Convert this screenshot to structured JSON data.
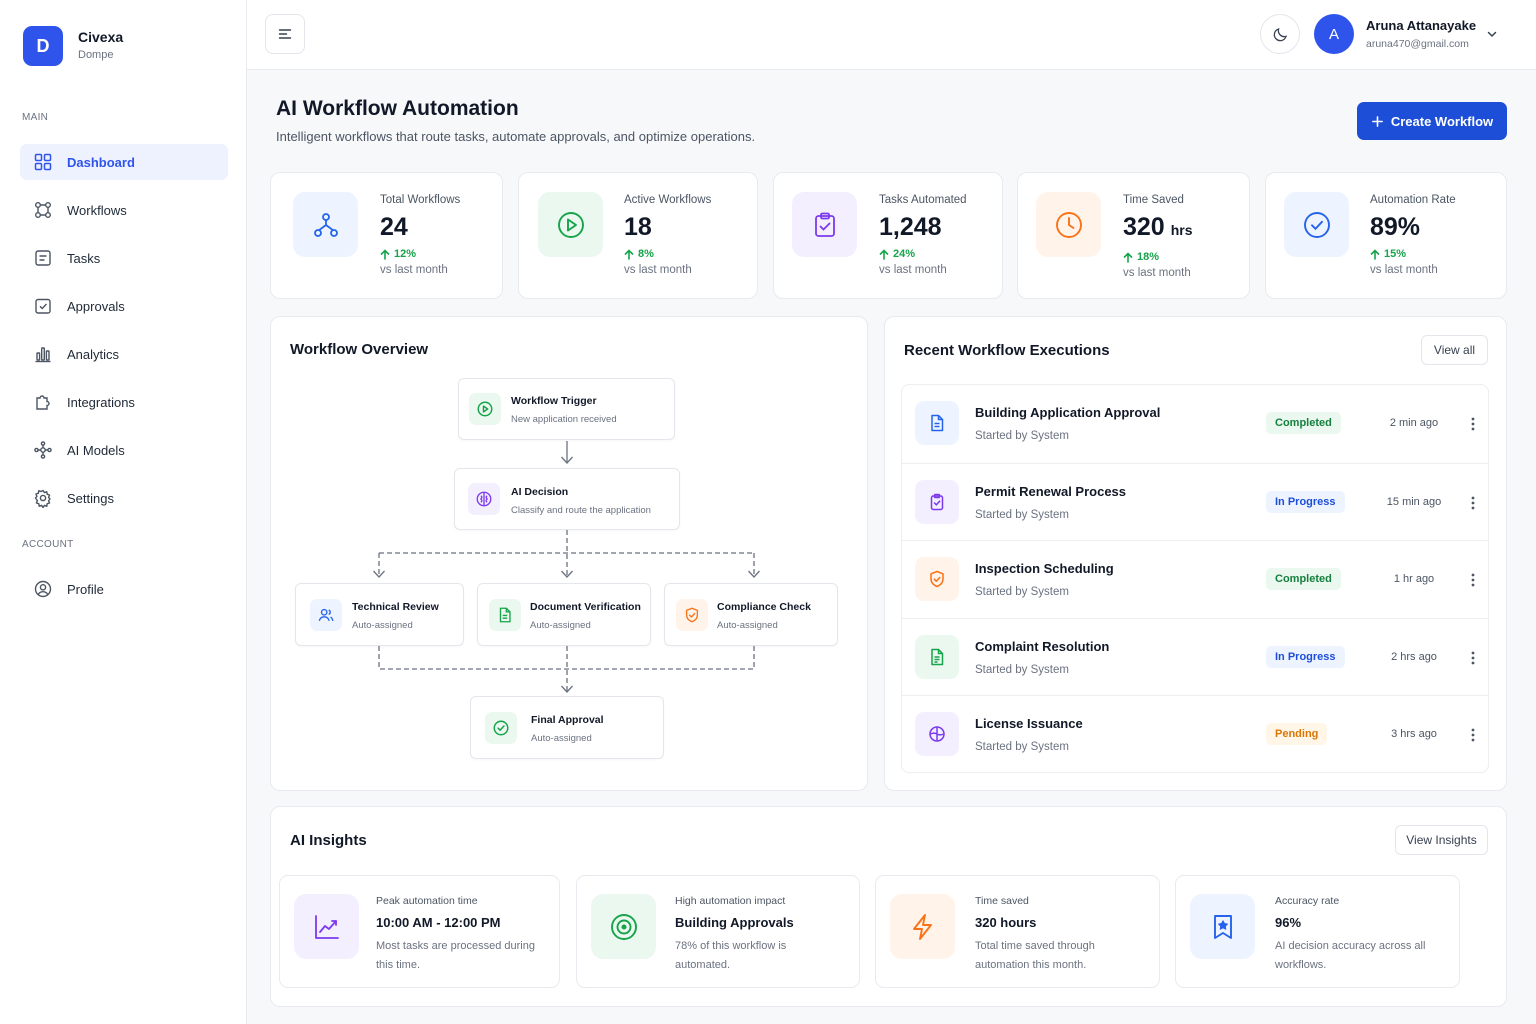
{
  "brand": {
    "logo_letter": "D",
    "name": "Civexa",
    "subtitle": "Dompe"
  },
  "sidebar": {
    "section_main": "MAIN",
    "section_account": "ACCOUNT",
    "items": [
      {
        "label": "Dashboard",
        "icon": "dashboard-icon",
        "active": true
      },
      {
        "label": "Workflows",
        "icon": "workflow-icon"
      },
      {
        "label": "Tasks",
        "icon": "tasks-icon"
      },
      {
        "label": "Approvals",
        "icon": "approvals-icon"
      },
      {
        "label": "Analytics",
        "icon": "analytics-icon"
      },
      {
        "label": "Integrations",
        "icon": "integrations-icon"
      },
      {
        "label": "AI Models",
        "icon": "ai-models-icon"
      },
      {
        "label": "Settings",
        "icon": "settings-icon"
      }
    ],
    "account_items": [
      {
        "label": "Profile",
        "icon": "profile-icon"
      }
    ]
  },
  "topbar": {
    "user": {
      "initial": "A",
      "name": "Aruna Attanayake",
      "email": "aruna470@gmail.com"
    }
  },
  "header": {
    "title": "AI Workflow Automation",
    "subtitle": "Intelligent workflows that route tasks, automate approvals, and optimize operations.",
    "create_button": "Create Workflow"
  },
  "stats": [
    {
      "label": "Total Workflows",
      "value": "24",
      "unit": "",
      "change": "12%",
      "compare": "vs last month",
      "icon": "workflow-nodes-icon",
      "color": "#2563eb",
      "bg": "#eef4ff"
    },
    {
      "label": "Active Workflows",
      "value": "18",
      "unit": "",
      "change": "8%",
      "compare": "vs last month",
      "icon": "play-circle-icon",
      "color": "#16a34a",
      "bg": "#eaf8ef"
    },
    {
      "label": "Tasks Automated",
      "value": "1,248",
      "unit": "",
      "change": "24%",
      "compare": "vs last month",
      "icon": "clipboard-check-icon",
      "color": "#7c3aed",
      "bg": "#f3efff"
    },
    {
      "label": "Time Saved",
      "value": "320",
      "unit": "hrs",
      "change": "18%",
      "compare": "vs last month",
      "icon": "clock-icon",
      "color": "#f97316",
      "bg": "#fff3ea"
    },
    {
      "label": "Automation Rate",
      "value": "89%",
      "unit": "",
      "change": "15%",
      "compare": "vs last month",
      "icon": "check-circle-icon",
      "color": "#2563eb",
      "bg": "#eef4ff"
    }
  ],
  "overview": {
    "title": "Workflow Overview",
    "nodes": {
      "trigger": {
        "title": "Workflow Trigger",
        "subtitle": "New application received"
      },
      "decision": {
        "title": "AI Decision",
        "subtitle": "Classify and route the application"
      },
      "technical": {
        "title": "Technical Review",
        "subtitle": "Auto-assigned"
      },
      "document": {
        "title": "Document Verification",
        "subtitle": "Auto-assigned"
      },
      "compliance": {
        "title": "Compliance Check",
        "subtitle": "Auto-assigned"
      },
      "final": {
        "title": "Final Approval",
        "subtitle": "Auto-assigned"
      }
    }
  },
  "executions": {
    "title": "Recent Workflow Executions",
    "view_all": "View all",
    "rows": [
      {
        "title": "Building Application Approval",
        "subtitle": "Started by System",
        "status": "Completed",
        "time": "2 min ago",
        "icon": "document-icon"
      },
      {
        "title": "Permit Renewal Process",
        "subtitle": "Started by System",
        "status": "In Progress",
        "time": "15 min ago",
        "icon": "clipboard-icon"
      },
      {
        "title": "Inspection Scheduling",
        "subtitle": "Started by System",
        "status": "Completed",
        "time": "1 hr ago",
        "icon": "shield-icon"
      },
      {
        "title": "Complaint Resolution",
        "subtitle": "Started by System",
        "status": "In Progress",
        "time": "2 hrs ago",
        "icon": "file-text-icon"
      },
      {
        "title": "License Issuance",
        "subtitle": "Started by System",
        "status": "Pending",
        "time": "3 hrs ago",
        "icon": "badge-icon"
      }
    ]
  },
  "insights": {
    "title": "AI Insights",
    "view_button": "View Insights",
    "cards": [
      {
        "label": "Peak automation time",
        "value": "10:00 AM - 12:00 PM",
        "description": "Most tasks are processed during this time.",
        "icon": "trend-chart-icon"
      },
      {
        "label": "High automation impact",
        "value": "Building Approvals",
        "description": "78% of this workflow is automated.",
        "icon": "target-icon"
      },
      {
        "label": "Time saved",
        "value": "320 hours",
        "description": "Total time saved through automation this month.",
        "icon": "lightning-icon"
      },
      {
        "label": "Accuracy rate",
        "value": "96%",
        "description": "AI decision accuracy across all workflows.",
        "icon": "bookmark-star-icon"
      }
    ]
  }
}
